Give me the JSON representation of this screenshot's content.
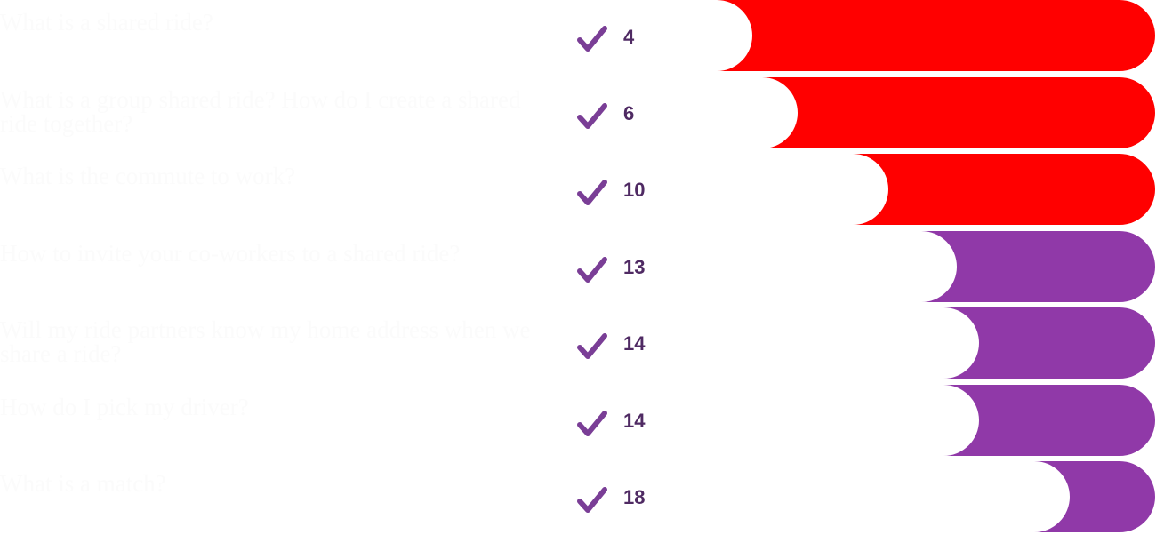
{
  "chart_data": {
    "type": "bar",
    "orientation": "horizontal",
    "categories": [
      "What is a shared ride?",
      "What is a group shared ride? How do I create a shared ride together?",
      "What is the commute to work?",
      "How to invite your co-workers to a shared ride?",
      "Will my ride partners know my home address when we share a ride?",
      "How do I pick my driver?",
      "What is a match?"
    ],
    "values": [
      4,
      6,
      10,
      13,
      14,
      14,
      18
    ],
    "value_labels": [
      "4",
      "6",
      "10",
      "13",
      "14",
      "14",
      "18"
    ],
    "xlim": [
      0,
      20
    ],
    "grid": false,
    "legend": "none"
  },
  "colors": {
    "high": "#ff0000",
    "low": "#9039a8",
    "check": "#7a3e96",
    "label": "#4f2a63"
  },
  "icons": {
    "row_marker": "checkmark-icon"
  }
}
